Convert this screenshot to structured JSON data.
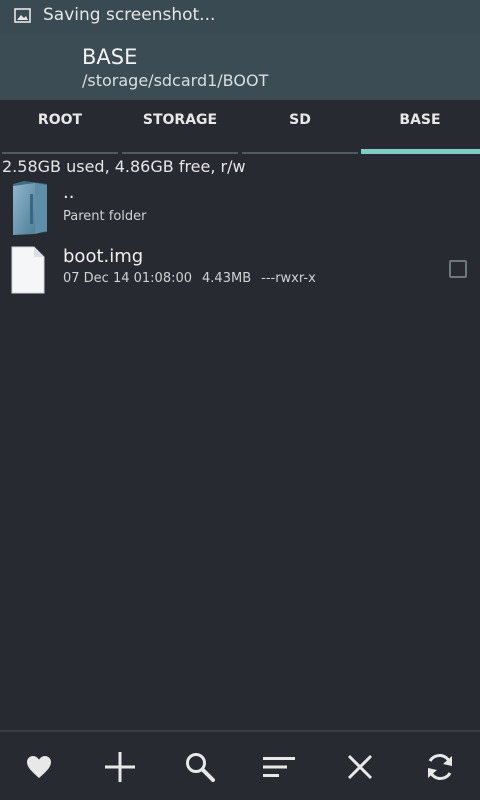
{
  "status_bar": {
    "icon": "image-icon",
    "text": "Saving screenshot..."
  },
  "action_bar": {
    "title": "BASE",
    "path": "/storage/sdcard1/BOOT"
  },
  "tabs": [
    {
      "label": "ROOT",
      "active": false
    },
    {
      "label": "STORAGE",
      "active": false
    },
    {
      "label": "SD",
      "active": false
    },
    {
      "label": "BASE",
      "active": true
    }
  ],
  "storage_info": "2.58GB used, 4.86GB free, r/w",
  "files": [
    {
      "name": "..",
      "subtitle": "Parent folder",
      "icon": "folder-icon"
    },
    {
      "name": "boot.img",
      "date": "07 Dec 14 01:08:00",
      "size": "4.43MB",
      "permissions": "---rwxr-x",
      "icon": "file-icon",
      "checked": false
    }
  ],
  "bottom_bar": {
    "icons": [
      "heart-icon",
      "plus-icon",
      "search-icon",
      "sort-icon",
      "close-icon",
      "refresh-icon"
    ]
  },
  "colors": {
    "accent": "#80cbc4",
    "action_bar": "#3b4c54",
    "background": "#272a31"
  }
}
